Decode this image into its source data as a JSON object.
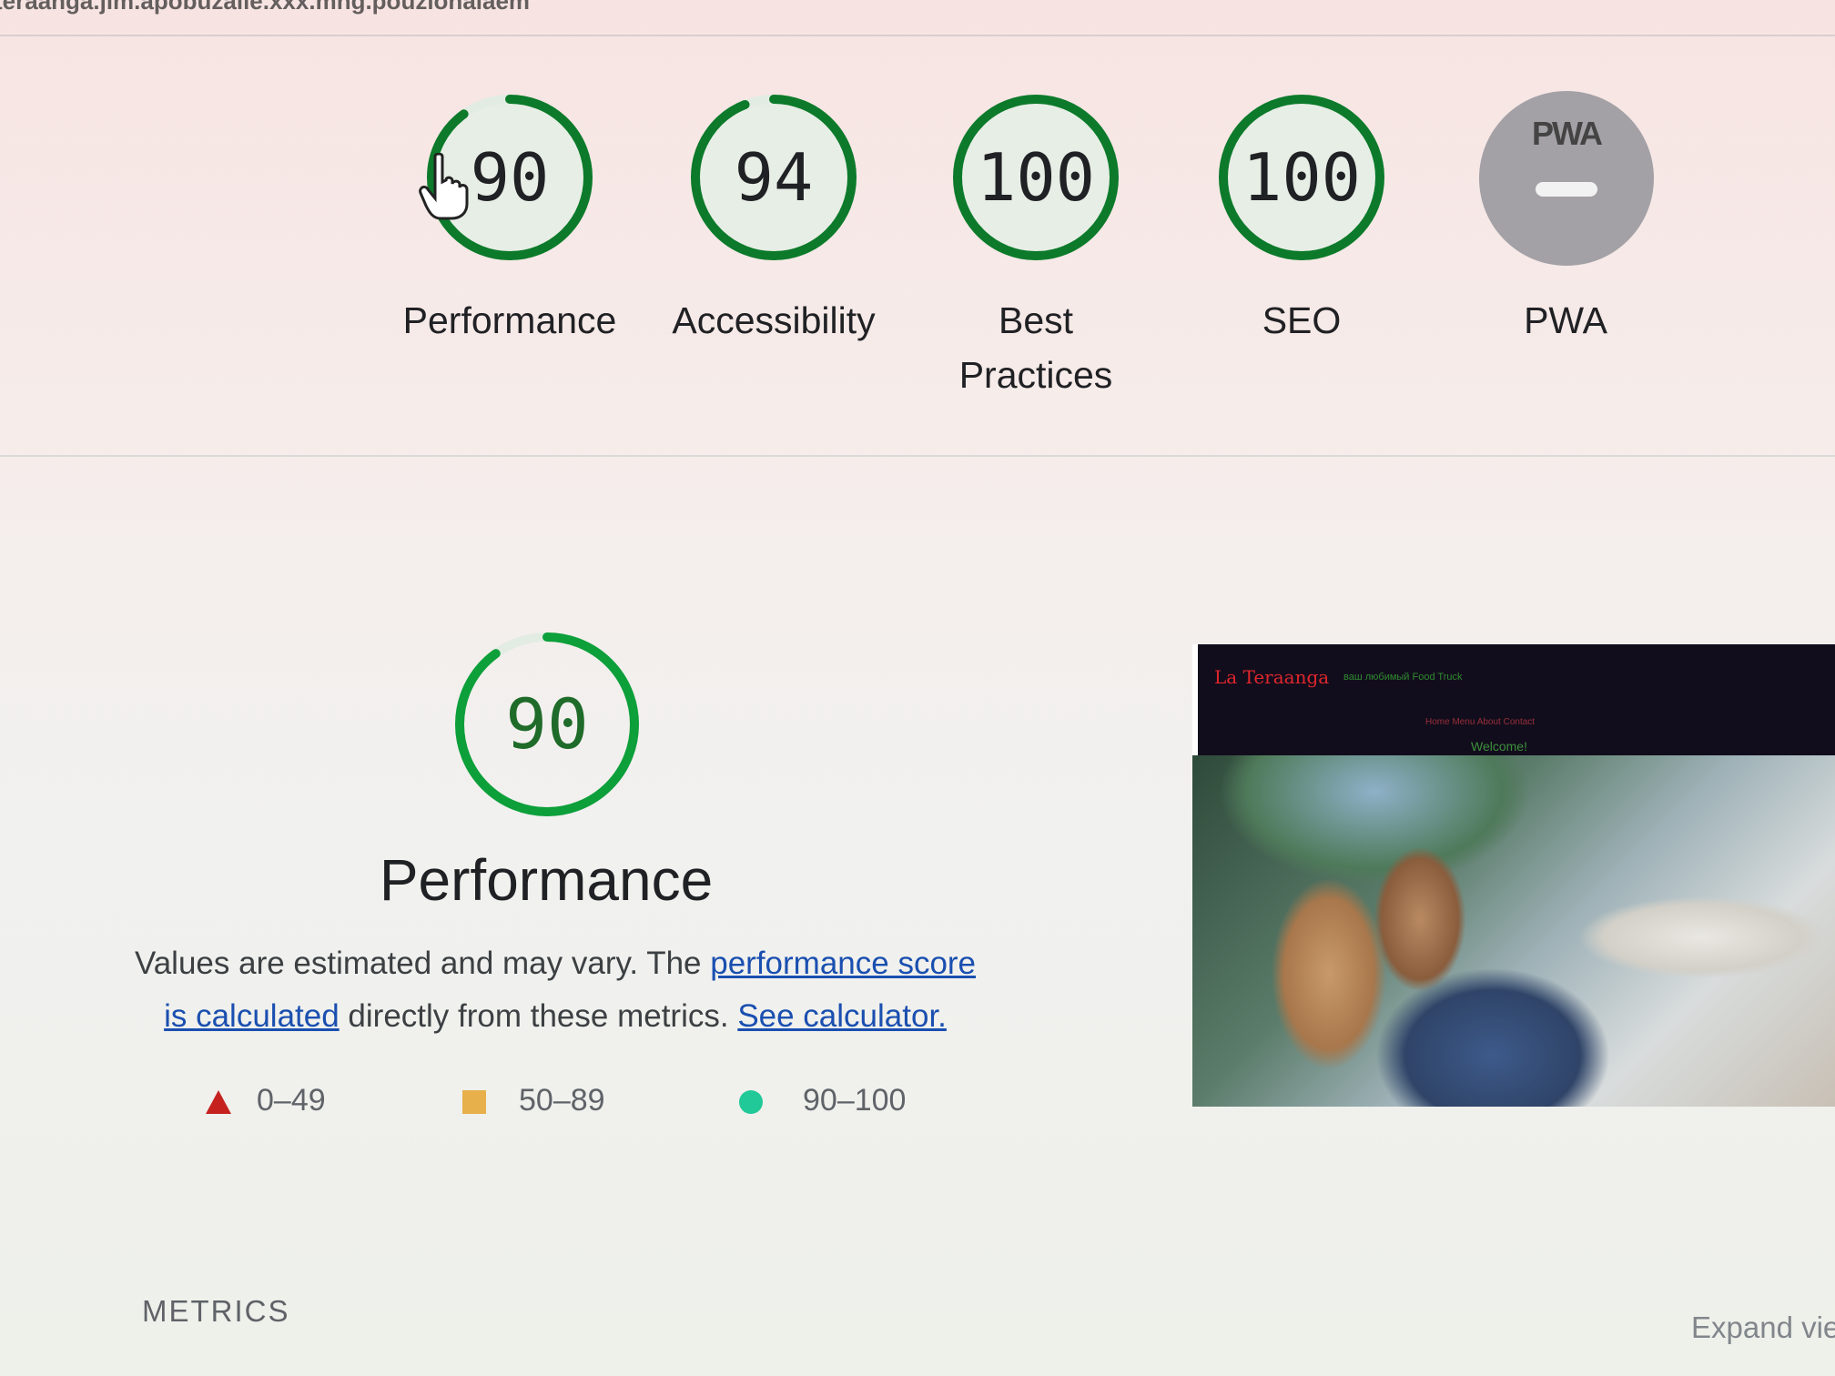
{
  "header": {
    "url_text": "teraanga.jim.apobuzalle.xxx.mng.pouzlonalaem"
  },
  "categories": [
    {
      "label": "Performance",
      "score": "90",
      "fraction": 0.9
    },
    {
      "label": "Accessibility",
      "score": "94",
      "fraction": 0.94
    },
    {
      "label": "Best Practices",
      "score": "100",
      "fraction": 1.0
    },
    {
      "label": "SEO",
      "score": "100",
      "fraction": 1.0
    }
  ],
  "pwa": {
    "badge": "PWA",
    "label": "PWA"
  },
  "performance": {
    "score": "90",
    "fraction": 0.9,
    "title": "Performance",
    "desc_text1": "Values are estimated and may vary. The ",
    "desc_link1": "performance score is calculated",
    "desc_text2": " directly from these metrics. ",
    "desc_link2": "See calculator."
  },
  "legend": {
    "fail": "0–49",
    "average": "50–89",
    "pass": "90–100"
  },
  "screenshot": {
    "brand": "La Teraanga",
    "tagline": "ваш любимый Food Truck",
    "nav": "Home  Menu  About  Contact",
    "welcome": "Welcome!"
  },
  "metrics": {
    "label": "METRICS",
    "expand": "Expand view"
  },
  "colors": {
    "pass": "#0c9f3a",
    "gauge_track": "#e3ece3",
    "fail": "#c5221f",
    "average": "#e8b04a",
    "pass_legend": "#20c997",
    "pwa_gray": "#a3a1a6",
    "link": "#1a4fb0"
  }
}
